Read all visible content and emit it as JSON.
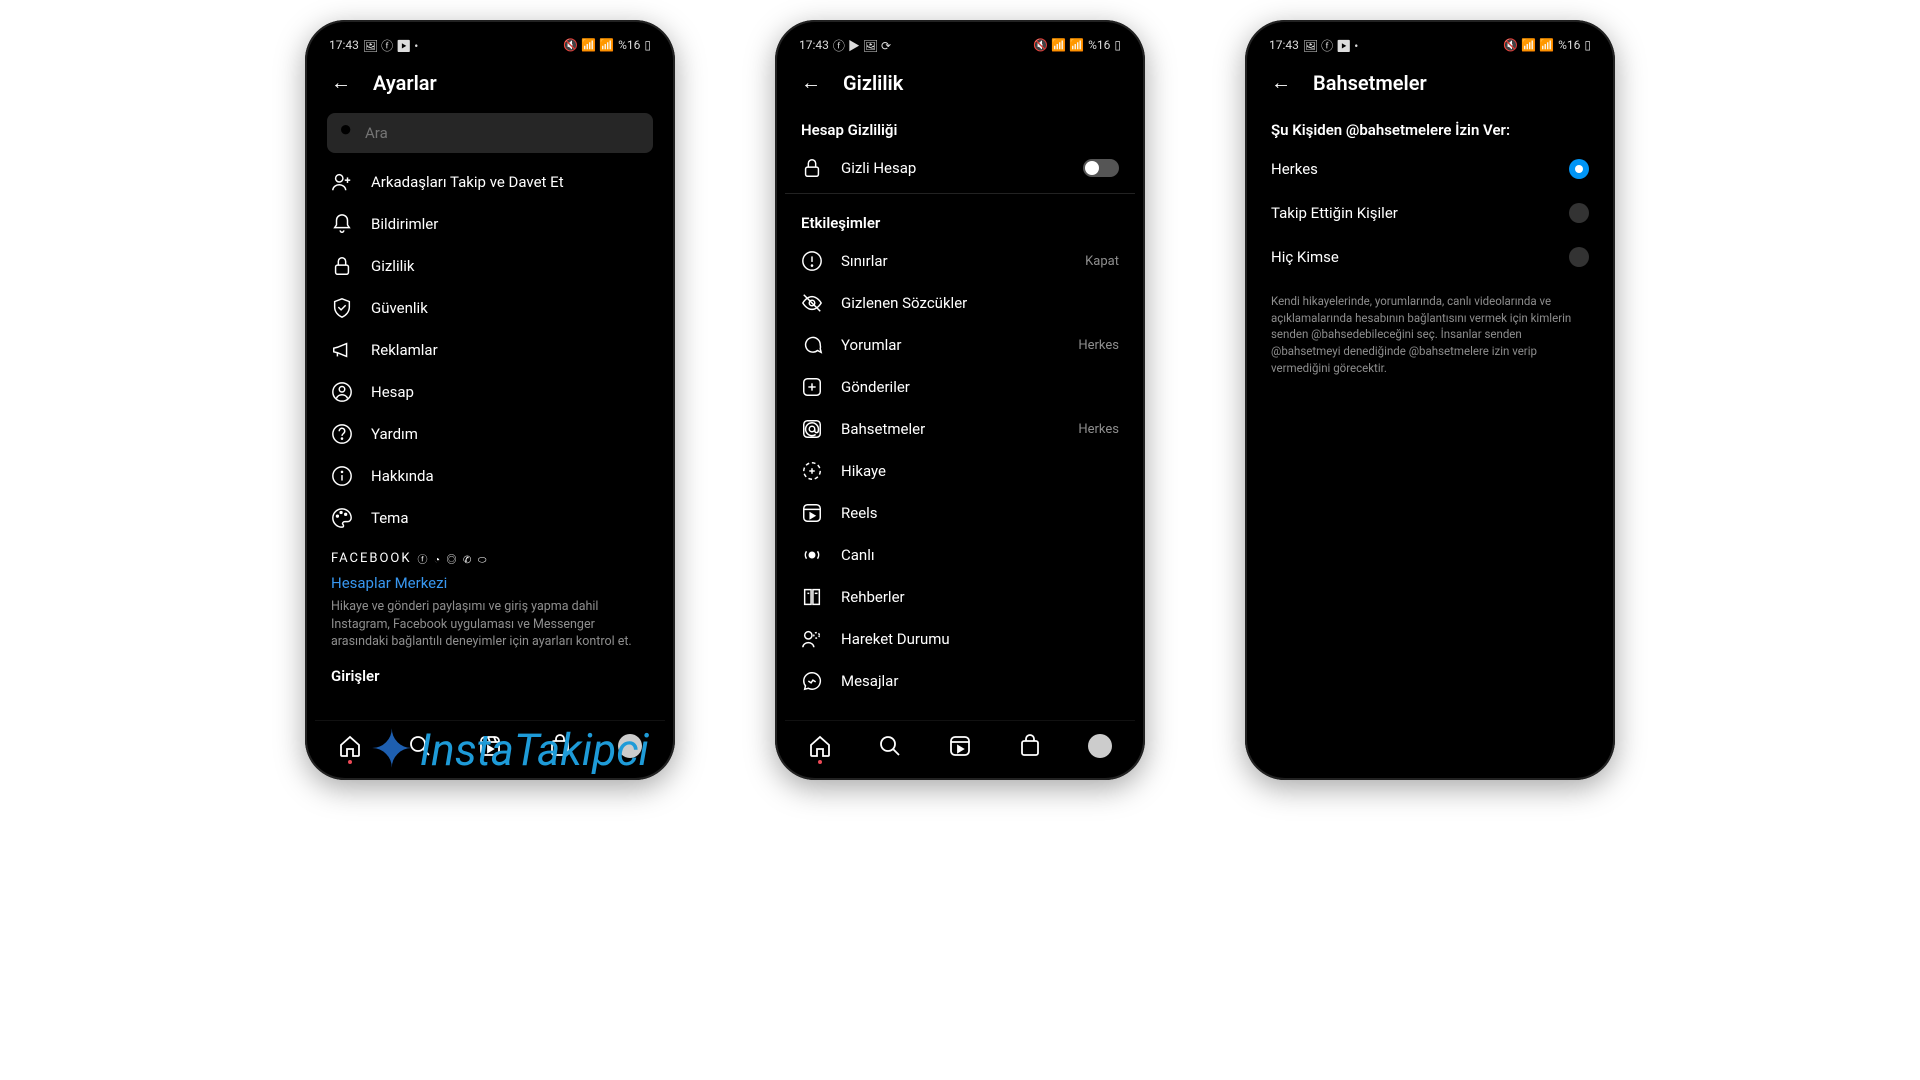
{
  "status_bar": {
    "time": "17:43",
    "battery": "%16"
  },
  "screen1": {
    "title": "Ayarlar",
    "search_placeholder": "Ara",
    "items": {
      "invite": "Arkadaşları Takip ve Davet Et",
      "notifications": "Bildirimler",
      "privacy": "Gizlilik",
      "security": "Güvenlik",
      "ads": "Reklamlar",
      "account": "Hesap",
      "help": "Yardım",
      "about": "Hakkında",
      "theme": "Tema"
    },
    "facebook_label": "FACEBOOK",
    "accounts_center": "Hesaplar Merkezi",
    "accounts_desc": "Hikaye ve gönderi paylaşımı ve giriş yapma dahil Instagram, Facebook uygulaması ve Messenger arasındaki bağlantılı deneyimler için ayarları kontrol et.",
    "logins_label": "Girişler"
  },
  "screen2": {
    "title": "Gizlilik",
    "section_privacy": "Hesap Gizliliği",
    "private_account": "Gizli Hesap",
    "section_interactions": "Etkileşimler",
    "items": {
      "limits": "Sınırlar",
      "limits_status": "Kapat",
      "hidden_words": "Gizlenen Sözcükler",
      "comments": "Yorumlar",
      "comments_status": "Herkes",
      "posts": "Gönderiler",
      "mentions": "Bahsetmeler",
      "mentions_status": "Herkes",
      "story": "Hikaye",
      "reels": "Reels",
      "live": "Canlı",
      "guides": "Rehberler",
      "activity_status": "Hareket Durumu",
      "messages": "Mesajlar"
    }
  },
  "screen3": {
    "title": "Bahsetmeler",
    "heading": "Şu Kişiden @bahsetmelere İzin Ver:",
    "options": {
      "everyone": "Herkes",
      "following": "Takip Ettiğin Kişiler",
      "noone": "Hiç Kimse"
    },
    "description": "Kendi hikayelerinde, yorumlarında, canlı videolarında ve açıklamalarında hesabının bağlantısını vermek için kimlerin senden @bahsedebileceğini seç. İnsanlar senden @bahsetmeyi denediğinde @bahsetmelere izin verip vermediğini görecektir."
  },
  "watermark": "InstaTakipci"
}
